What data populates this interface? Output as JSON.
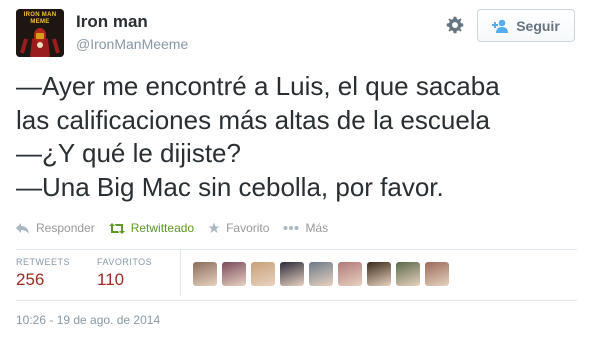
{
  "profile": {
    "name": "Iron man",
    "handle": "@IronManMeeme",
    "avatar_text": "IRON MAN MEME",
    "avatar_color": "#1d1612"
  },
  "follow_button": {
    "label": "Seguir",
    "icon": "add-user-icon"
  },
  "settings_icon": "gear-icon",
  "tweet": {
    "lines": [
      "—Ayer me encontré a Luis, el que sacaba",
      "las calificaciones más altas de la escuela",
      "—¿Y qué le dijiste?",
      "—Una Big Mac sin cebolla, por favor."
    ]
  },
  "actions": [
    {
      "label": "Responder",
      "icon": "reply-icon"
    },
    {
      "label": "Retwitteado",
      "icon": "retweet-icon",
      "active_color": "#609928"
    },
    {
      "label": "Favorito",
      "icon": "star-icon"
    },
    {
      "label": "Más",
      "icon": "more-icon"
    }
  ],
  "stats": {
    "retweets": {
      "label": "RETWEETS",
      "value": "256"
    },
    "favorites": {
      "label": "FAVORITOS",
      "value": "110"
    }
  },
  "favoriter_avatar_colors": [
    "#8a6d5a",
    "#7a4a5e",
    "#c9a07a",
    "#2b2b3a",
    "#6c7a8a",
    "#b07a7a",
    "#3a2a1a",
    "#5a6a4a",
    "#9a6a5a"
  ],
  "timestamp": "10:26 - 19 de ago. de 2014",
  "colors": {
    "text": "#292f33",
    "muted": "#8899a6",
    "stat_value": "#a02a24",
    "retweet_active": "#609928"
  }
}
